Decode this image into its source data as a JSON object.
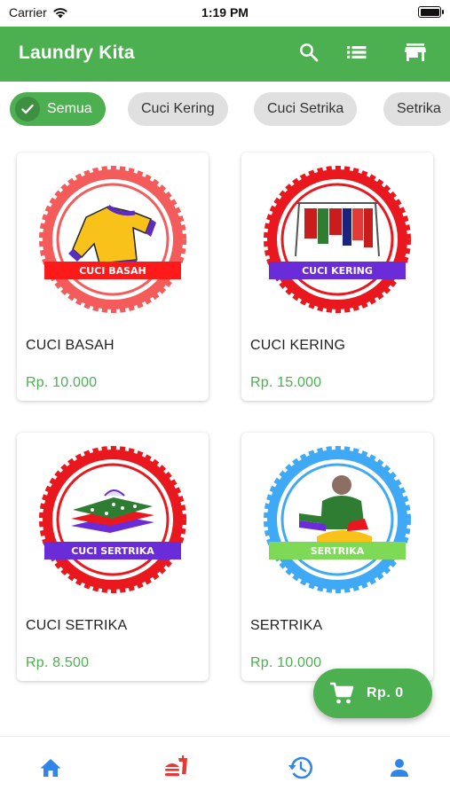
{
  "status": {
    "carrier": "Carrier",
    "time": "1:19 PM"
  },
  "appbar": {
    "title": "Laundry Kita",
    "color": "#4caf50",
    "actions": [
      "search-icon",
      "list-icon",
      "store-icon"
    ]
  },
  "chips": [
    {
      "label": "Semua",
      "selected": true
    },
    {
      "label": "Cuci Kering",
      "selected": false
    },
    {
      "label": "Cuci Setrika",
      "selected": false
    },
    {
      "label": "Setrika",
      "selected": false
    }
  ],
  "products": [
    {
      "name": "CUCI BASAH",
      "price": "Rp. 10.000",
      "badge_text": "CUCI BASAH",
      "ring_color": "#f45b5b",
      "ribbon_color": "#ff1a1a"
    },
    {
      "name": "CUCI KERING",
      "price": "Rp. 15.000",
      "badge_text": "CUCI KERING",
      "ring_color": "#e8181e",
      "ribbon_color": "#6a2bd8"
    },
    {
      "name": "CUCI SETRIKA",
      "price": "Rp. 8.500",
      "badge_text": "CUCI SERTRIKA",
      "ring_color": "#e8181e",
      "ribbon_color": "#6a2bd8"
    },
    {
      "name": "SERTRIKA",
      "price": "Rp. 10.000",
      "badge_text": "SERTRIKA",
      "ring_color": "#3fa9f5",
      "ribbon_color": "#7ed957"
    }
  ],
  "cart": {
    "total": "Rp. 0"
  },
  "bottom_nav": [
    {
      "icon": "home-icon",
      "active": true
    },
    {
      "icon": "fastfood-icon",
      "active": false
    },
    {
      "icon": "history-icon",
      "active": false
    },
    {
      "icon": "person-icon",
      "active": false
    }
  ],
  "colors": {
    "accent": "#4caf50",
    "nav_blue": "#2f86e8",
    "nav_red": "#e53935"
  }
}
